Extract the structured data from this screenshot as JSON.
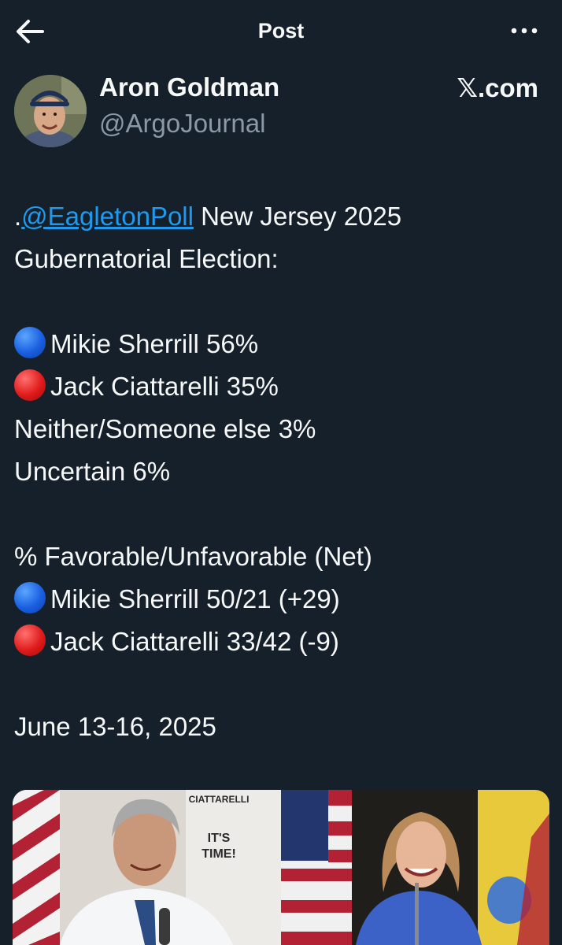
{
  "topbar": {
    "title": "Post",
    "back_icon": "arrow-left-icon",
    "more_icon": "more-horizontal-icon"
  },
  "author": {
    "name": "Aron Goldman",
    "handle": "@ArgoJournal",
    "brand": "𝕏.com"
  },
  "tweet": {
    "mention": "@EagletonPoll",
    "line1_prefix": ".",
    "line1_rest": " New Jersey 2025",
    "line2": "Gubernatorial Election:",
    "results": [
      {
        "marker": "blue",
        "text": "Mikie Sherrill 56%"
      },
      {
        "marker": "red",
        "text": "Jack Ciattarelli 35%"
      },
      {
        "marker": "",
        "text": "Neither/Someone else 3%"
      },
      {
        "marker": "",
        "text": "Uncertain 6%"
      }
    ],
    "favorability_header": "% Favorable/Unfavorable (Net)",
    "favorability": [
      {
        "marker": "blue",
        "text": "Mikie Sherrill 50/21 (+29)"
      },
      {
        "marker": "red",
        "text": "Jack Ciattarelli 33/42 (-9)"
      }
    ],
    "date": "June 13-16, 2025"
  },
  "media": {
    "sign_text_top": "CIATTARELLI",
    "sign_text_1": "IT'S",
    "sign_text_2": "TIME!"
  },
  "colors": {
    "background": "#15202b",
    "link": "#1d9bf0",
    "muted": "#8b98a5",
    "democrat_marker": "#1a5fe0",
    "republican_marker": "#e01b1b"
  }
}
